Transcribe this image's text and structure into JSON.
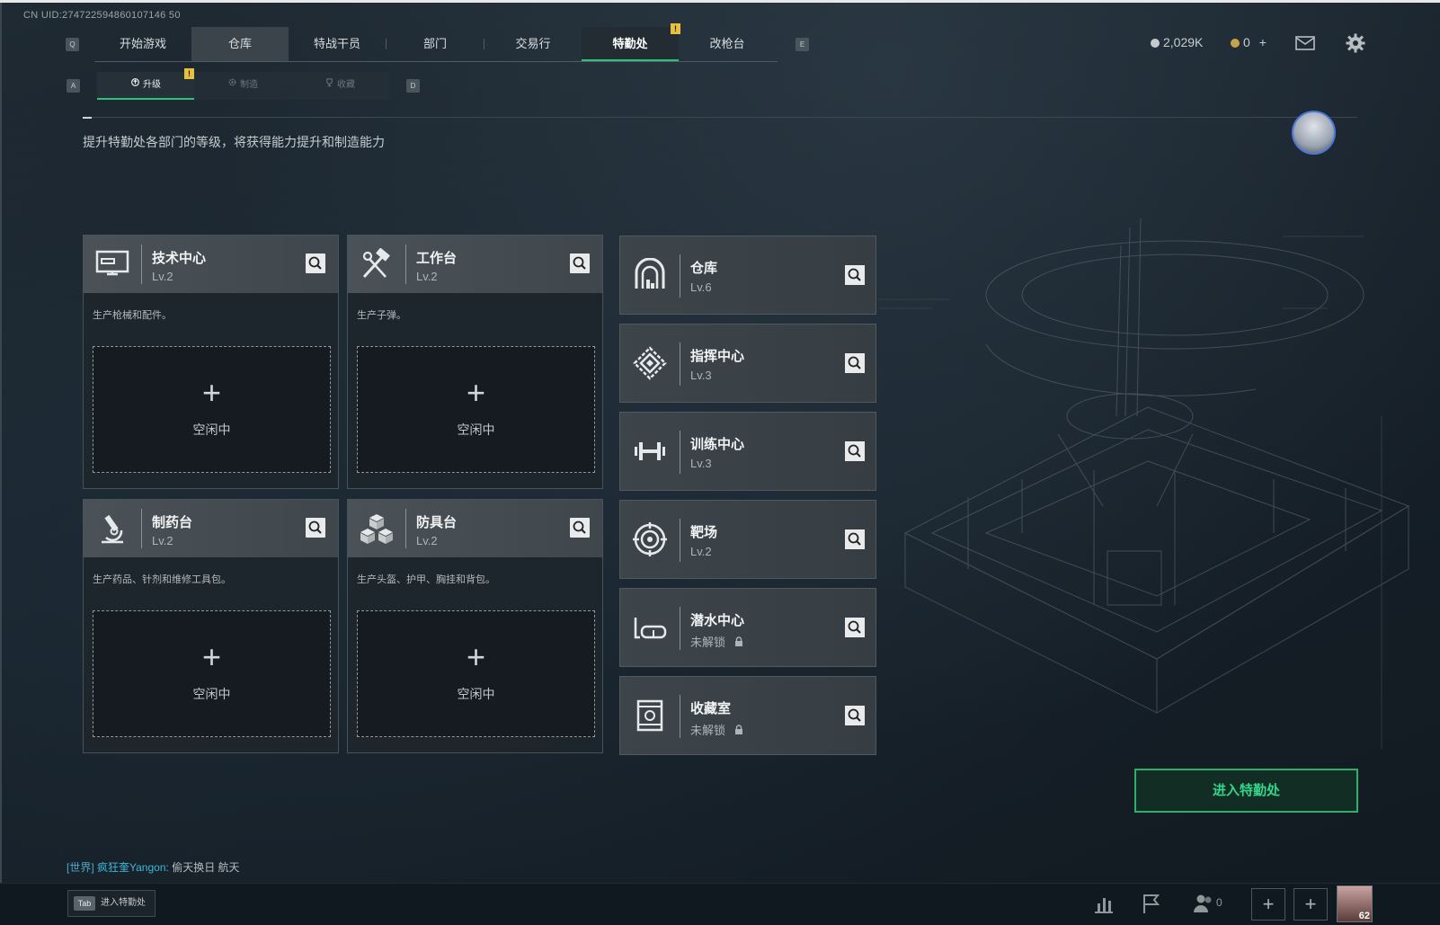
{
  "uid": "CN UID:274722594860107146 50",
  "nav": {
    "left_key": "Q",
    "right_key": "E",
    "tabs": [
      {
        "label": "开始游戏"
      },
      {
        "label": "仓库"
      },
      {
        "label": "特战干员"
      },
      {
        "label": "部门"
      },
      {
        "label": "交易行"
      },
      {
        "label": "特勤处"
      },
      {
        "label": "改枪台"
      }
    ],
    "badge": "!"
  },
  "subnav": {
    "left_key": "A",
    "right_key": "D",
    "tabs": [
      {
        "label": "升级",
        "icon": "upgrade-icon"
      },
      {
        "label": "制造",
        "icon": "gear-icon"
      },
      {
        "label": "收藏",
        "icon": "trophy-icon"
      }
    ],
    "badge": "!"
  },
  "currency": {
    "silver": "2,029K",
    "gold": "0",
    "gold_add": "+"
  },
  "description": "提升特勤处各部门的等级，将获得能力提升和制造能力",
  "facilities_large": [
    {
      "name": "技术中心",
      "level": "Lv.2",
      "desc": "生产枪械和配件。",
      "slot": "空闲中",
      "icon": "computer-icon"
    },
    {
      "name": "工作台",
      "level": "Lv.2",
      "desc": "生产子弹。",
      "slot": "空闲中",
      "icon": "tools-icon"
    },
    {
      "name": "制药台",
      "level": "Lv.2",
      "desc": "生产药品、针剂和维修工具包。",
      "slot": "空闲中",
      "icon": "microscope-icon"
    },
    {
      "name": "防具台",
      "level": "Lv.2",
      "desc": "生产头盔、护甲、胸挂和背包。",
      "slot": "空闲中",
      "icon": "cubes-icon"
    }
  ],
  "facilities_small": [
    {
      "name": "仓库",
      "level": "Lv.6",
      "icon": "warehouse-icon"
    },
    {
      "name": "指挥中心",
      "level": "Lv.3",
      "icon": "command-icon"
    },
    {
      "name": "训练中心",
      "level": "Lv.3",
      "icon": "dumbbell-icon"
    },
    {
      "name": "靶场",
      "level": "Lv.2",
      "icon": "target-icon"
    },
    {
      "name": "潜水中心",
      "level": "未解锁",
      "icon": "goggles-icon",
      "locked": true
    },
    {
      "name": "收藏室",
      "level": "未解锁",
      "icon": "vault-icon",
      "locked": true
    }
  ],
  "enter_button": "进入特勤处",
  "chat": {
    "channel": "[世界]",
    "name": "疯狂奎Yangon:",
    "message": "偷天换日 航天"
  },
  "bottom": {
    "tab_key": "Tab",
    "tab_hint": "进入特勤处",
    "friends_count": "0",
    "player_level": "62"
  },
  "colors": {
    "accent_green": "#2fc37a",
    "badge_yellow": "#e8c13c",
    "chat_blue": "#3fb6d9"
  }
}
